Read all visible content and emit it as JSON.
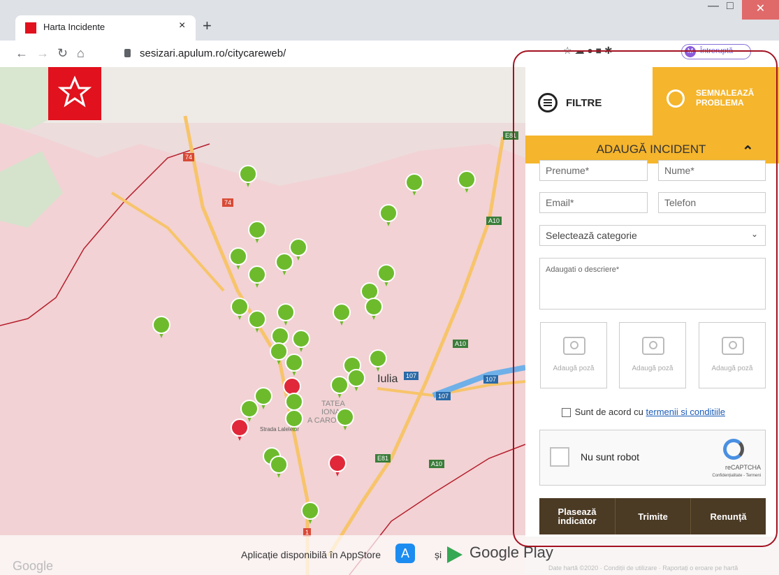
{
  "browser": {
    "tab_title": "Harta Incidente",
    "tab_close": "×",
    "new_tab": "+",
    "url": "sesizari.apulum.ro/citycareweb/",
    "profile_initial": "M",
    "profile_status": "Întreruptă"
  },
  "map": {
    "city_label": "Iulia",
    "area_label_1": "TATEA",
    "area_label_2": "IONA",
    "area_label_3": "A CARO",
    "street_label": "Strada Lalelelor",
    "road_labels": [
      "E81",
      "74",
      "74",
      "A10",
      "A10",
      "107",
      "107",
      "107",
      "E81",
      "A10",
      "1"
    ],
    "google_logo": "Google",
    "footer_links": "Date hartă ©2020 · Condiții de utilizare · Raportați o eroare pe hartă"
  },
  "app_banner": {
    "text": "Aplicație disponibilă în AppStore",
    "and": "și",
    "google_play": "Google Play"
  },
  "panel": {
    "tab_filters": "FILTRE",
    "tab_report": "SEMNALEAZĂ PROBLEMA",
    "section_title": "ADAUGĂ INCIDENT",
    "first_name_placeholder": "Prenume*",
    "last_name_placeholder": "Nume*",
    "email_placeholder": "Email*",
    "phone_placeholder": "Telefon",
    "category_select": "Selectează categorie",
    "description_placeholder": "Adaugati o descriere*",
    "photo_labels": [
      "Adaugă poză",
      "Adaugă poză",
      "Adaugă poză"
    ],
    "agree_prefix": "Sunt de acord cu",
    "agree_link": "termenii si conditiile",
    "captcha_label": "Nu sunt robot",
    "captcha_brand": "reCAPTCHA",
    "captcha_links": "Confidențialitate - Termeni",
    "btn_place": "Plasează indicator",
    "btn_send": "Trimite",
    "btn_cancel": "Renunță"
  }
}
